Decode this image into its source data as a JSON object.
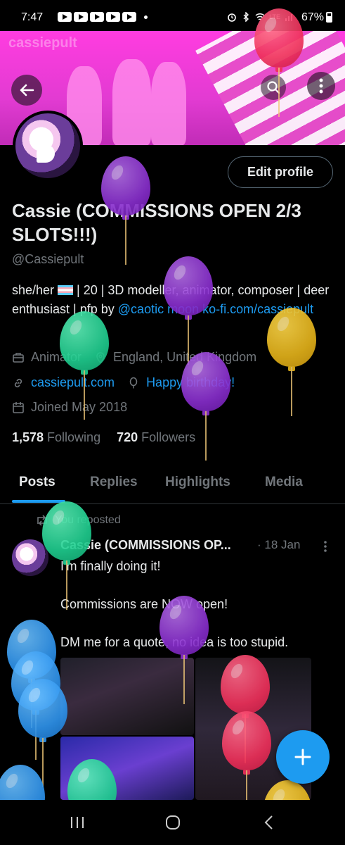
{
  "status_bar": {
    "time": "7:47",
    "battery": "67%",
    "network": "LTE"
  },
  "banner": {
    "brand": "cassiepult"
  },
  "profile": {
    "edit_label": "Edit profile",
    "display_name": "Cassie (COMMISSIONS OPEN 2/3 SLOTS!!!)",
    "handle": "@Cassiepult",
    "bio": {
      "part1": "she/her ",
      "part2": " | 20 | 3D modeller, animator, composer | deer enthusiast | pfp by ",
      "mention": "@caotic moon",
      "space": " ",
      "kofi": "ko-fi.com/cassiepult"
    },
    "profession": "Animator",
    "location": "England, United Kingdom",
    "website": "cassiepult.com",
    "birthday": "Happy birthday!",
    "joined": "Joined May 2018",
    "following_count": "1,578",
    "following_label": "Following",
    "followers_count": "720",
    "followers_label": "Followers"
  },
  "tabs": [
    {
      "label": "Posts"
    },
    {
      "label": "Replies"
    },
    {
      "label": "Highlights"
    },
    {
      "label": "Media"
    }
  ],
  "post": {
    "repost_label": "You reposted",
    "author": "Cassie (COMMISSIONS OP...",
    "date": "· 18 Jan",
    "line1": "I'm finally doing it!",
    "line2": "Commissions are NOW open!",
    "line3": "DM me for a quote, no idea is too stupid."
  },
  "colors": {
    "accent": "#1d9bf0",
    "background": "#000000",
    "muted": "#71767b",
    "banner": "#ff3ce0"
  },
  "icons": {
    "fab": "plus-icon",
    "back": "arrow-left-icon",
    "search": "search-icon",
    "more": "more-vertical-icon"
  }
}
